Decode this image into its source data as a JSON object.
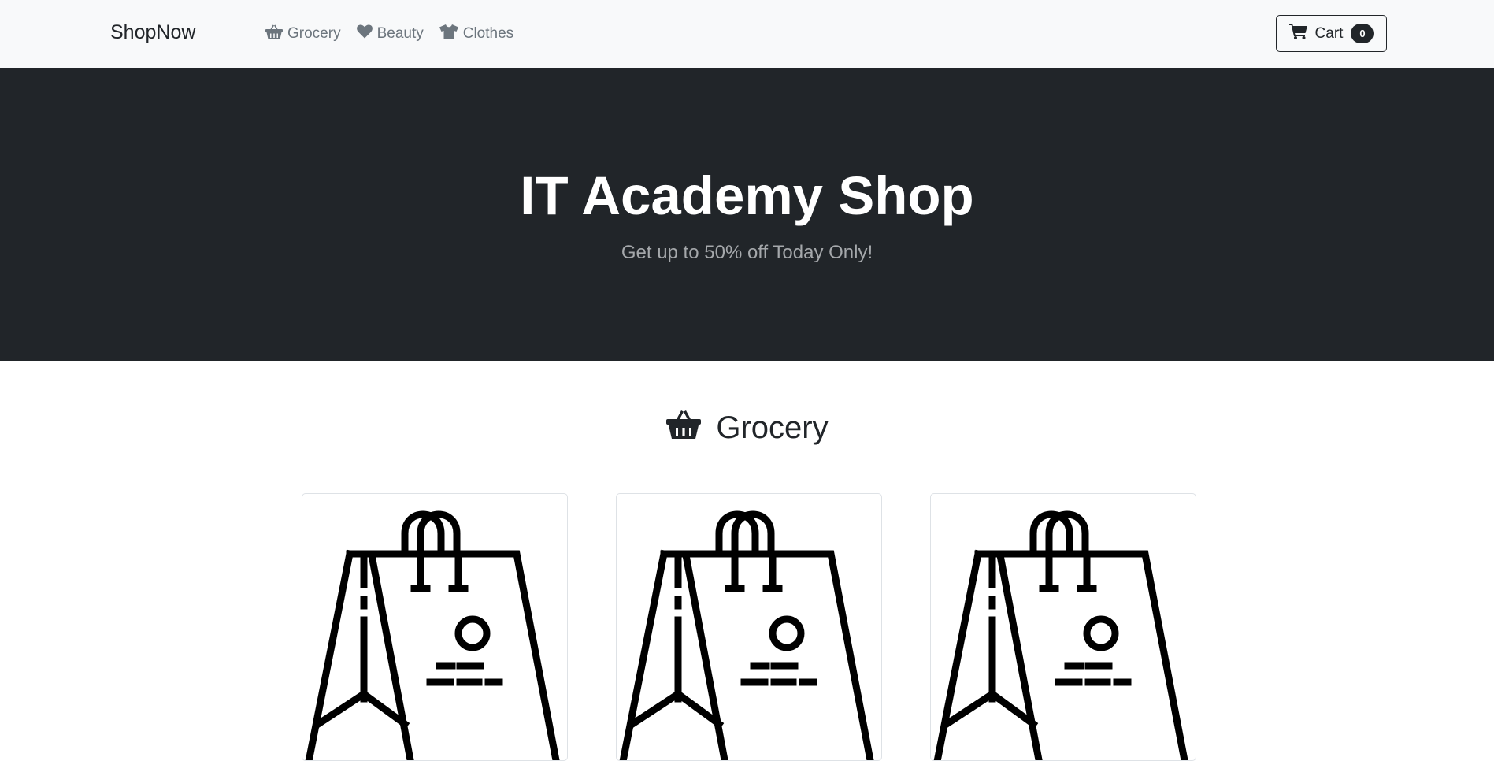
{
  "navbar": {
    "brand": "ShopNow",
    "links": [
      {
        "label": "Grocery",
        "icon": "basket-icon"
      },
      {
        "label": "Beauty",
        "icon": "heart-icon"
      },
      {
        "label": "Clothes",
        "icon": "tshirt-icon"
      }
    ],
    "cart": {
      "label": "Cart",
      "count": "0",
      "icon": "cart-icon"
    }
  },
  "hero": {
    "title": "IT Academy Shop",
    "subtitle": "Get up to 50% off Today Only!"
  },
  "section": {
    "title": "Grocery",
    "icon": "basket-icon",
    "products": [
      {
        "image": "shopping-bag-icon"
      },
      {
        "image": "shopping-bag-icon"
      },
      {
        "image": "shopping-bag-icon"
      }
    ]
  },
  "colors": {
    "navbar_bg": "#f8f9fa",
    "hero_bg": "#212529",
    "muted": "#6c757d"
  }
}
